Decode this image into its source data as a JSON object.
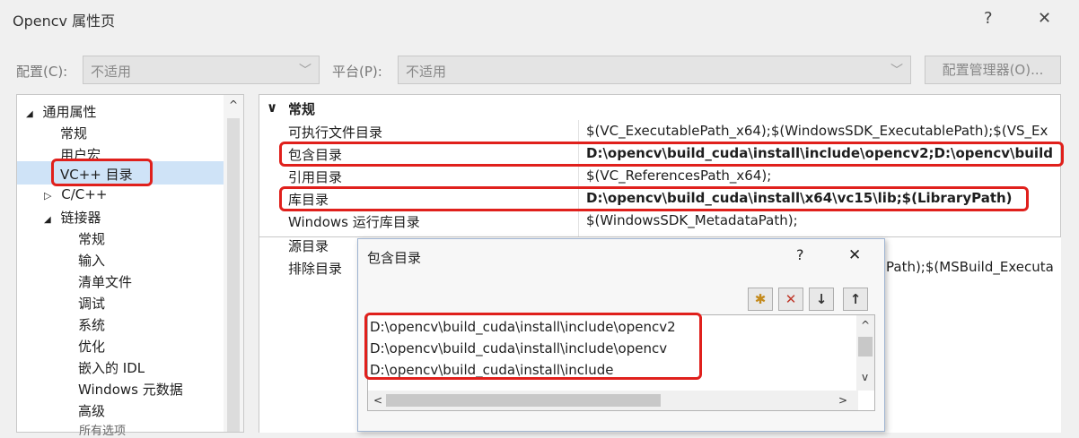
{
  "window": {
    "title": "Opencv 属性页",
    "help": "?",
    "close": "✕"
  },
  "toolbar": {
    "config_label": "配置(C):",
    "config_value": "不适用",
    "platform_label": "平台(P):",
    "platform_value": "不适用",
    "config_manager": "配置管理器(O)..."
  },
  "tree": {
    "items": [
      {
        "label": "通用属性",
        "expander": "◢"
      },
      {
        "label": "常规"
      },
      {
        "label": "用户宏"
      },
      {
        "label": "VC++ 目录",
        "selected": true
      },
      {
        "label": "C/C++",
        "expander": "▷"
      },
      {
        "label": "链接器",
        "expander": "◢"
      },
      {
        "label": "常规"
      },
      {
        "label": "输入"
      },
      {
        "label": "清单文件"
      },
      {
        "label": "调试"
      },
      {
        "label": "系统"
      },
      {
        "label": "优化"
      },
      {
        "label": "嵌入的 IDL"
      },
      {
        "label": "Windows 元数据"
      },
      {
        "label": "高级"
      }
    ],
    "scroll_up": "^"
  },
  "grid": {
    "section": "常规",
    "section_expander": "∨",
    "rows": [
      {
        "name": "可执行文件目录",
        "value": "$(VC_ExecutablePath_x64);$(WindowsSDK_ExecutablePath);$(VS_Ex"
      },
      {
        "name": "包含目录",
        "value": "D:\\opencv\\build_cuda\\install\\include\\opencv2;D:\\opencv\\build",
        "bold": true
      },
      {
        "name": "引用目录",
        "value": "$(VC_ReferencesPath_x64);"
      },
      {
        "name": "库目录",
        "value": "D:\\opencv\\build_cuda\\install\\x64\\vc15\\lib;$(LibraryPath)",
        "bold": true
      },
      {
        "name": "Windows 运行库目录",
        "value": "$(WindowsSDK_MetadataPath);"
      },
      {
        "name": "源目录",
        "value": ""
      },
      {
        "name": "排除目录",
        "value": "Path);$(MSBuild_Executa"
      }
    ]
  },
  "dialog": {
    "title": "包含目录",
    "help": "?",
    "close": "✕",
    "toolbar": {
      "new": "✱",
      "delete": "✕",
      "down": "↓",
      "up": "↑"
    },
    "lines": [
      "D:\\opencv\\build_cuda\\install\\include\\opencv2",
      "D:\\opencv\\build_cuda\\install\\include\\opencv",
      "D:\\opencv\\build_cuda\\install\\include"
    ],
    "scroll": {
      "up": "^",
      "down": "v",
      "left": "<",
      "right": ">"
    }
  },
  "overlay_text": "所有选项",
  "colors": {
    "highlight_red": "#e0201c",
    "selection": "#cfe3f7",
    "delete_red": "#c0392b"
  }
}
